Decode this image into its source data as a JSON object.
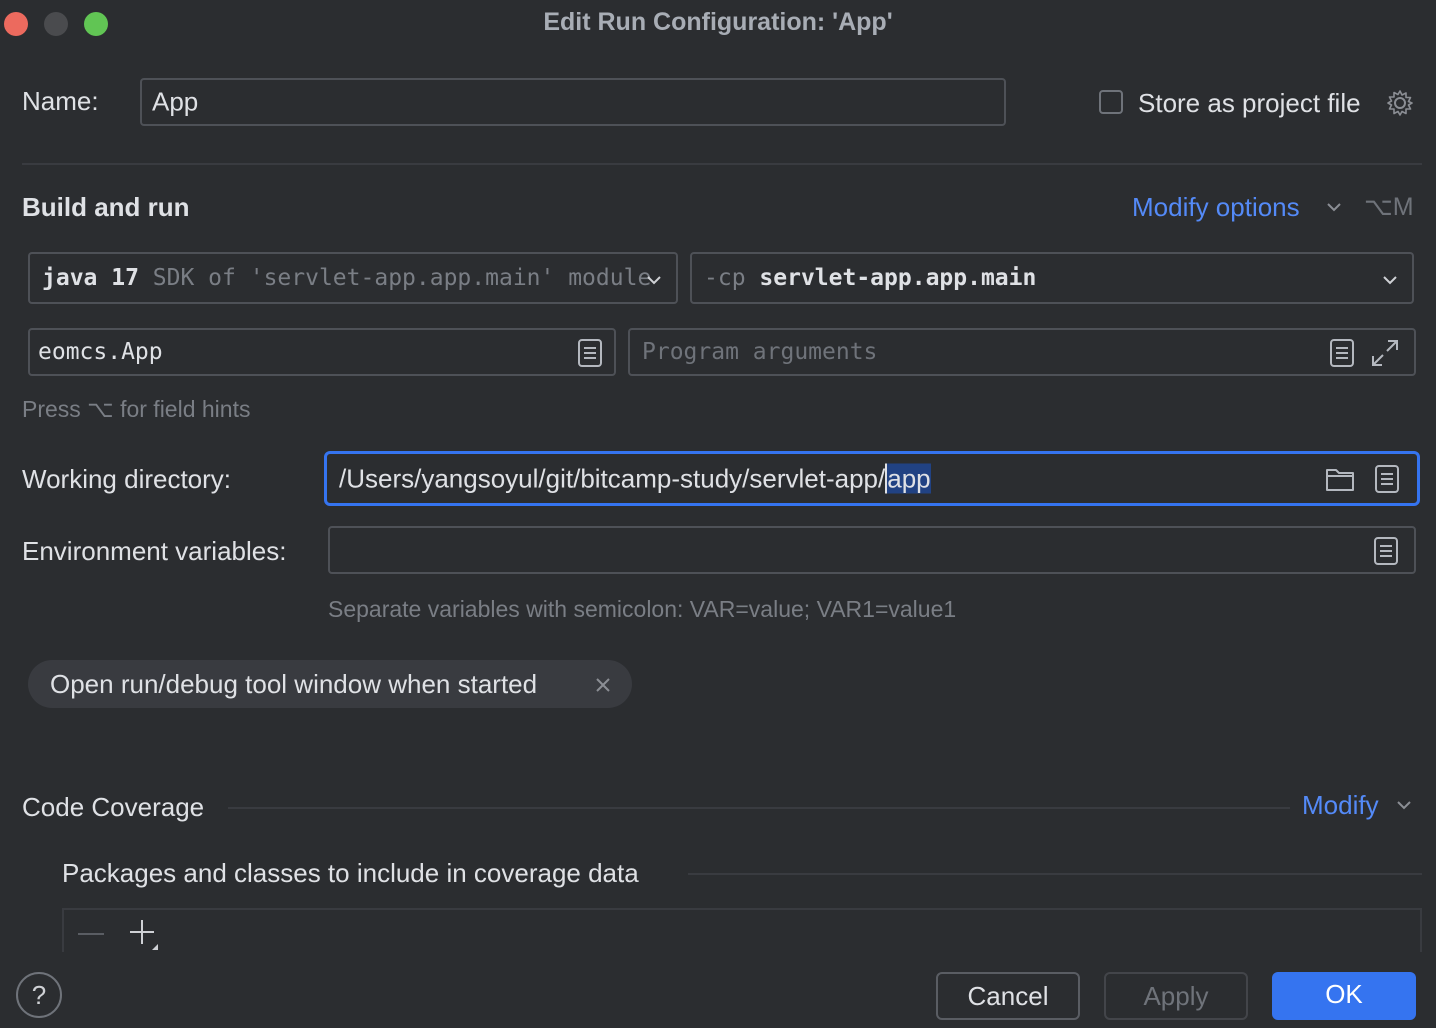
{
  "window": {
    "title": "Edit Run Configuration: 'App'"
  },
  "name_row": {
    "label": "Name:",
    "value": "App",
    "store_label": "Store as project file"
  },
  "build_run": {
    "heading": "Build and run",
    "modify_options": "Modify options",
    "modify_shortcut": "⌥M",
    "sdk": {
      "java": "java 17",
      "desc": "SDK of 'servlet-app.app.main' module"
    },
    "classpath": {
      "flag": "-cp",
      "module": "servlet-app.app.main"
    },
    "main_class": "eomcs.App",
    "program_args_placeholder": "Program arguments",
    "field_hint": "Press ⌥ for field hints"
  },
  "working_dir": {
    "label": "Working directory:",
    "value_prefix": "/Users/yangsoyul/git/bitcamp-study/servlet-app/",
    "value_selected": "app"
  },
  "env": {
    "label": "Environment variables:",
    "value": "",
    "hint": "Separate variables with semicolon: VAR=value; VAR1=value1"
  },
  "chip": {
    "label": "Open run/debug tool window when started"
  },
  "coverage": {
    "heading": "Code Coverage",
    "modify": "Modify",
    "packages_label": "Packages and classes to include in coverage data"
  },
  "buttons": {
    "cancel": "Cancel",
    "apply": "Apply",
    "ok": "OK",
    "help": "?"
  },
  "colors": {
    "accent": "#548af7",
    "ok": "#3574f0",
    "close": "#ff5f57",
    "minimize": "#4a4b4e",
    "zoom": "#28c840"
  }
}
